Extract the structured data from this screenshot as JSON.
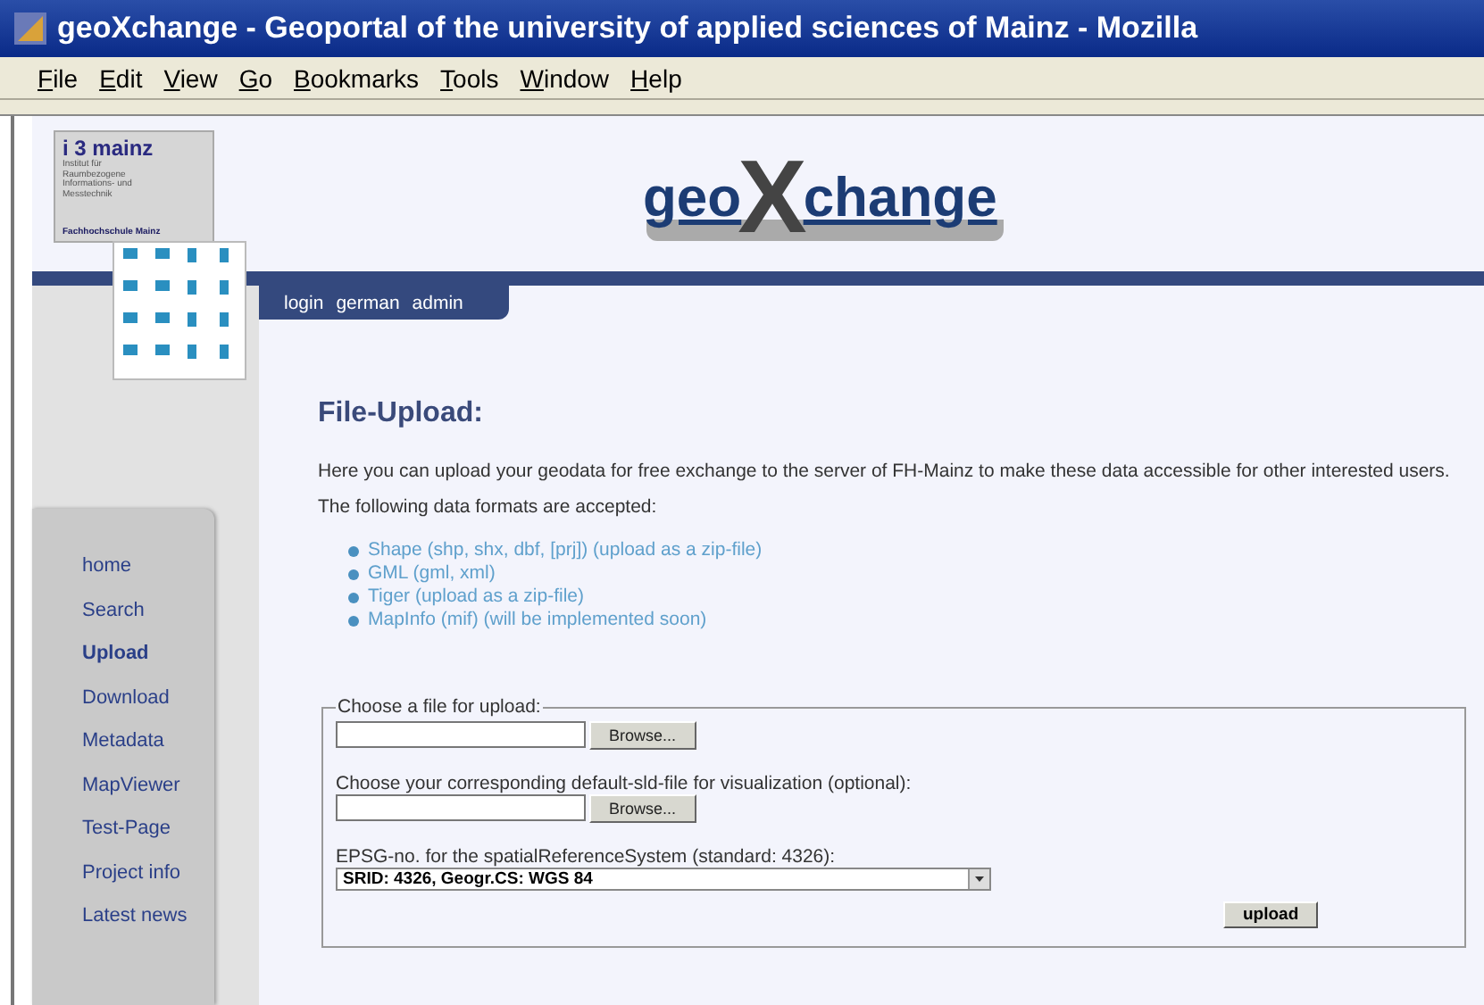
{
  "window": {
    "title": "geoXchange - Geoportal of the university of applied sciences of Mainz - Mozilla"
  },
  "menu_bar": [
    "File",
    "Edit",
    "View",
    "Go",
    "Bookmarks",
    "Tools",
    "Window",
    "Help"
  ],
  "logo": {
    "name": "i 3 mainz",
    "institute": "Institut für Raumbezogene Informations- und Messtechnik",
    "school": "Fachhochschule Mainz"
  },
  "brand": {
    "left": "geo",
    "middle": "X",
    "right": "change"
  },
  "top_links": [
    "login",
    "german",
    "admin"
  ],
  "sidebar": {
    "items": [
      {
        "label": "home",
        "selected": false
      },
      {
        "label": "Search",
        "selected": false
      },
      {
        "label": "Upload",
        "selected": true
      },
      {
        "label": "Download",
        "selected": false
      },
      {
        "label": "Metadata",
        "selected": false
      },
      {
        "label": "MapViewer",
        "selected": false
      },
      {
        "label": "Test-Page",
        "selected": false
      },
      {
        "label": "Project info",
        "selected": false
      },
      {
        "label": "Latest news",
        "selected": false
      }
    ]
  },
  "page": {
    "title": "File-Upload:",
    "intro": "Here you can upload your geodata for free exchange to the server of FH-Mainz to make these data accessible for other interested users.",
    "formats_label": "The following data formats are accepted:",
    "formats": [
      "Shape (shp, shx, dbf, [prj]) (upload as a zip-file)",
      "GML (gml, xml)",
      "Tiger (upload as a zip-file)",
      "MapInfo (mif) (will be implemented soon)"
    ]
  },
  "form": {
    "legend": "Choose a file for upload:",
    "file_button": "Browse...",
    "sld_label": "Choose your corresponding default-sld-file for visualization (optional):",
    "sld_button": "Browse...",
    "epsg_label": "EPSG-no. for the spatialReferenceSystem (standard: 4326):",
    "epsg_value": "SRID: 4326, Geogr.CS: WGS 84",
    "submit": "upload"
  }
}
